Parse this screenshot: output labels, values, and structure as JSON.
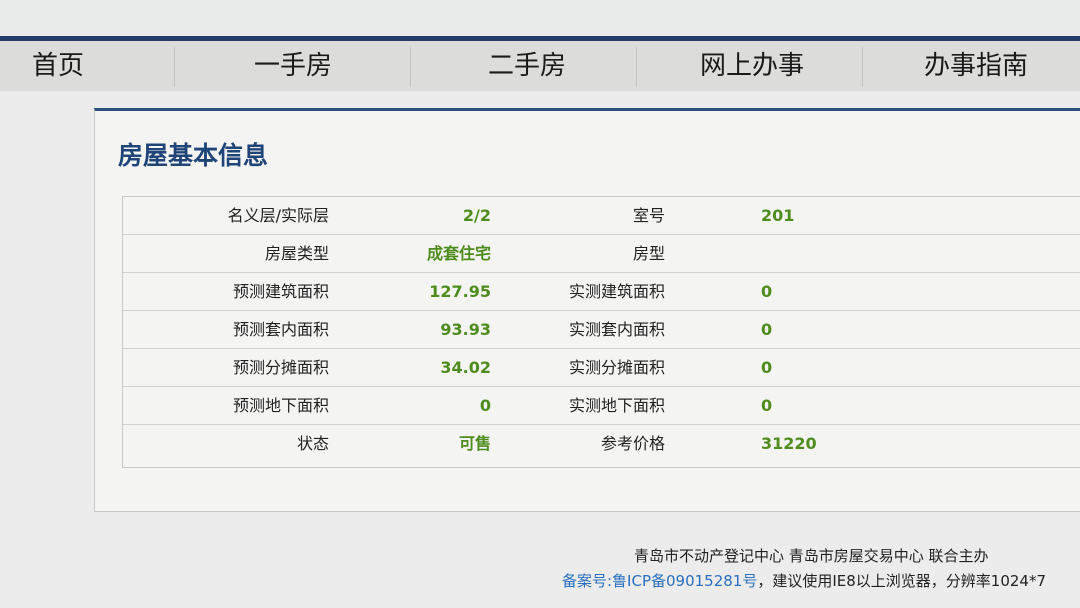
{
  "nav": {
    "items": [
      "首页",
      "一手房",
      "二手房",
      "网上办事",
      "办事指南"
    ]
  },
  "panel": {
    "title": "房屋基本信息"
  },
  "info_table": {
    "rows": [
      {
        "label1": "名义层/实际层",
        "value1": "2/2",
        "label2": "室号",
        "value2": "201"
      },
      {
        "label1": "房屋类型",
        "value1": "成套住宅",
        "label2": "房型",
        "value2": ""
      },
      {
        "label1": "预测建筑面积",
        "value1": "127.95",
        "label2": "实测建筑面积",
        "value2": "0"
      },
      {
        "label1": "预测套内面积",
        "value1": "93.93",
        "label2": "实测套内面积",
        "value2": "0"
      },
      {
        "label1": "预测分摊面积",
        "value1": "34.02",
        "label2": "实测分摊面积",
        "value2": "0"
      },
      {
        "label1": "预测地下面积",
        "value1": "0",
        "label2": "实测地下面积",
        "value2": "0"
      },
      {
        "label1": "状态",
        "value1": "可售",
        "label2": "参考价格",
        "value2": "31220"
      }
    ]
  },
  "footer": {
    "organizers": "青岛市不动产登记中心 青岛市房屋交易中心 联合主办",
    "icp": "备案号:鲁ICP备09015281号",
    "notice": "，建议使用IE8以上浏览器，分辨率1024*7"
  },
  "colors": {
    "nav_rule": "#243a6a",
    "title": "#1e4478",
    "value": "#4f8c1e",
    "link": "#2a6fc0"
  }
}
